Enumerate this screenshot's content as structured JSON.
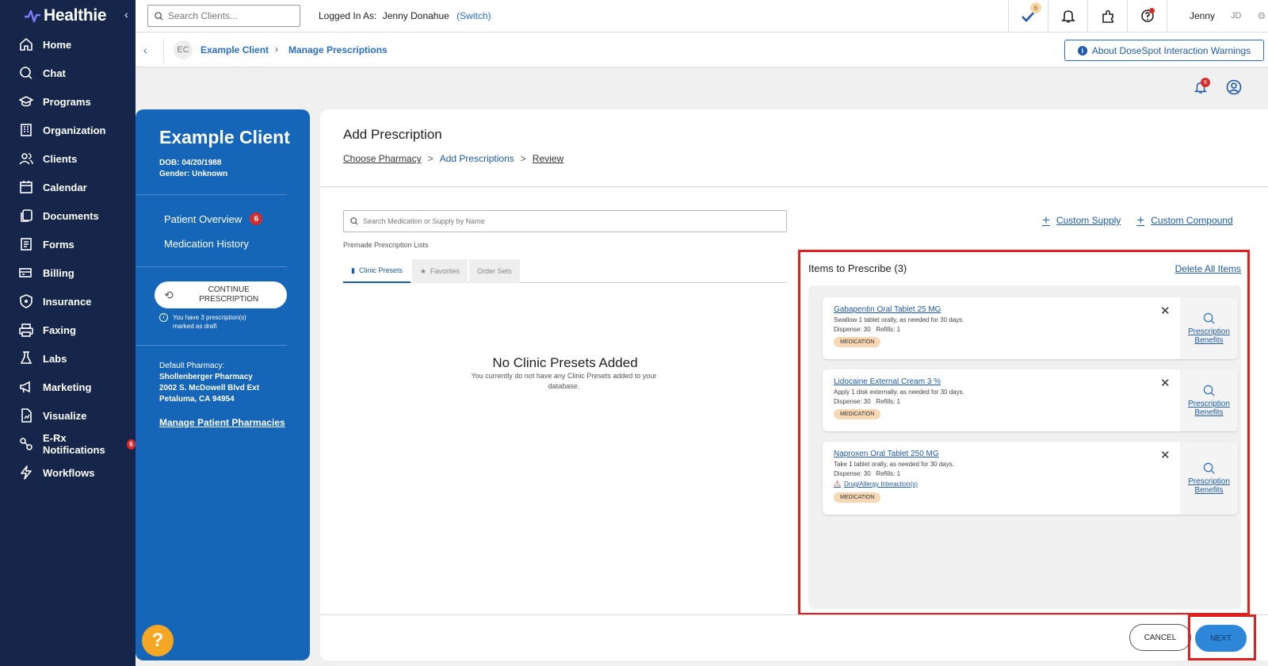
{
  "brand": {
    "name": "Healthie"
  },
  "nav": {
    "items": [
      {
        "label": "Home",
        "icon": "home-icon"
      },
      {
        "label": "Chat",
        "icon": "chat-icon"
      },
      {
        "label": "Programs",
        "icon": "programs-icon"
      },
      {
        "label": "Organization",
        "icon": "organization-icon"
      },
      {
        "label": "Clients",
        "icon": "clients-icon"
      },
      {
        "label": "Calendar",
        "icon": "calendar-icon"
      },
      {
        "label": "Documents",
        "icon": "documents-icon"
      },
      {
        "label": "Forms",
        "icon": "forms-icon"
      },
      {
        "label": "Billing",
        "icon": "billing-icon"
      },
      {
        "label": "Insurance",
        "icon": "insurance-icon"
      },
      {
        "label": "Faxing",
        "icon": "fax-icon"
      },
      {
        "label": "Labs",
        "icon": "labs-icon"
      },
      {
        "label": "Marketing",
        "icon": "marketing-icon"
      },
      {
        "label": "Visualize",
        "icon": "visualize-icon"
      },
      {
        "label": "E-Rx Notifications",
        "icon": "erx-icon",
        "badge": "6"
      },
      {
        "label": "Workflows",
        "icon": "workflows-icon"
      }
    ]
  },
  "topbar": {
    "search_placeholder": "Search Clients...",
    "logged_in_label": "Logged In As:",
    "user_full_name": "Jenny Donahue",
    "switch_label": "(Switch)",
    "tasks_badge": "6",
    "user_first_name": "Jenny",
    "user_initials": "JD"
  },
  "breadcrumb": {
    "avatar_initials": "EC",
    "client": "Example Client",
    "current": "Manage Prescriptions",
    "about_button": "About DoseSpot Interaction Warnings"
  },
  "notifications_badge": "6",
  "patient": {
    "name": "Example Client",
    "dob": "DOB: 04/20/1988",
    "gender": "Gender: Unknown",
    "overview_label": "Patient Overview",
    "overview_badge": "6",
    "history_label": "Medication History",
    "continue_label": "CONTINUE PRESCRIPTION",
    "draft_note": "You have 3 prescription(s) marked as draft",
    "default_pharmacy_label": "Default Pharmacy:",
    "pharmacy_name": "Shollenberger Pharmacy",
    "pharmacy_address1": "2002 S. McDowell Blvd Ext",
    "pharmacy_address2": "Petaluma, CA 94954",
    "manage_pharmacies": "Manage Patient Pharmacies"
  },
  "main": {
    "title": "Add Prescription",
    "steps": [
      "Choose Pharmacy",
      "Add Prescriptions",
      "Review"
    ],
    "step_separator": ">",
    "med_search_placeholder": "Search Medication or Supply by Name",
    "premade_label": "Premade Prescription Lists",
    "tabs": [
      "Clinic Presets",
      "Favorites",
      "Order Sets"
    ],
    "empty_title": "No Clinic Presets Added",
    "empty_subtitle": "You currently do not have any Clinic Presets added to your database.",
    "custom_supply": "Custom Supply",
    "custom_compound": "Custom Compound",
    "items_title": "Items to Prescribe (3)",
    "delete_all": "Delete All Items",
    "items": [
      {
        "name": "Gabapentin Oral Tablet 25 MG",
        "sig": "Swallow 1 tablet orally, as needed for 30 days.",
        "dispense": "Dispense: 30",
        "refills": "Refills: 1",
        "warning": "",
        "tag": "MEDICATION",
        "benefits": [
          "Prescription",
          "Benefits"
        ]
      },
      {
        "name": "Lidocaine External Cream 3 %",
        "sig": "Apply 1 disk externally, as needed for 30 days.",
        "dispense": "Dispense: 30",
        "refills": "Refills: 1",
        "warning": "",
        "tag": "MEDICATION",
        "benefits": [
          "Prescription",
          "Benefits"
        ]
      },
      {
        "name": "Naproxen Oral Tablet 250 MG",
        "sig": "Take 1 tablet orally, as needed for 30 days.",
        "dispense": "Dispense: 30",
        "refills": "Refills: 1",
        "warning": "Drug/Allergy Interaction(s)",
        "tag": "MEDICATION",
        "benefits": [
          "Prescription",
          "Benefits"
        ]
      }
    ],
    "cancel": "CANCEL",
    "next": "NEXT"
  }
}
